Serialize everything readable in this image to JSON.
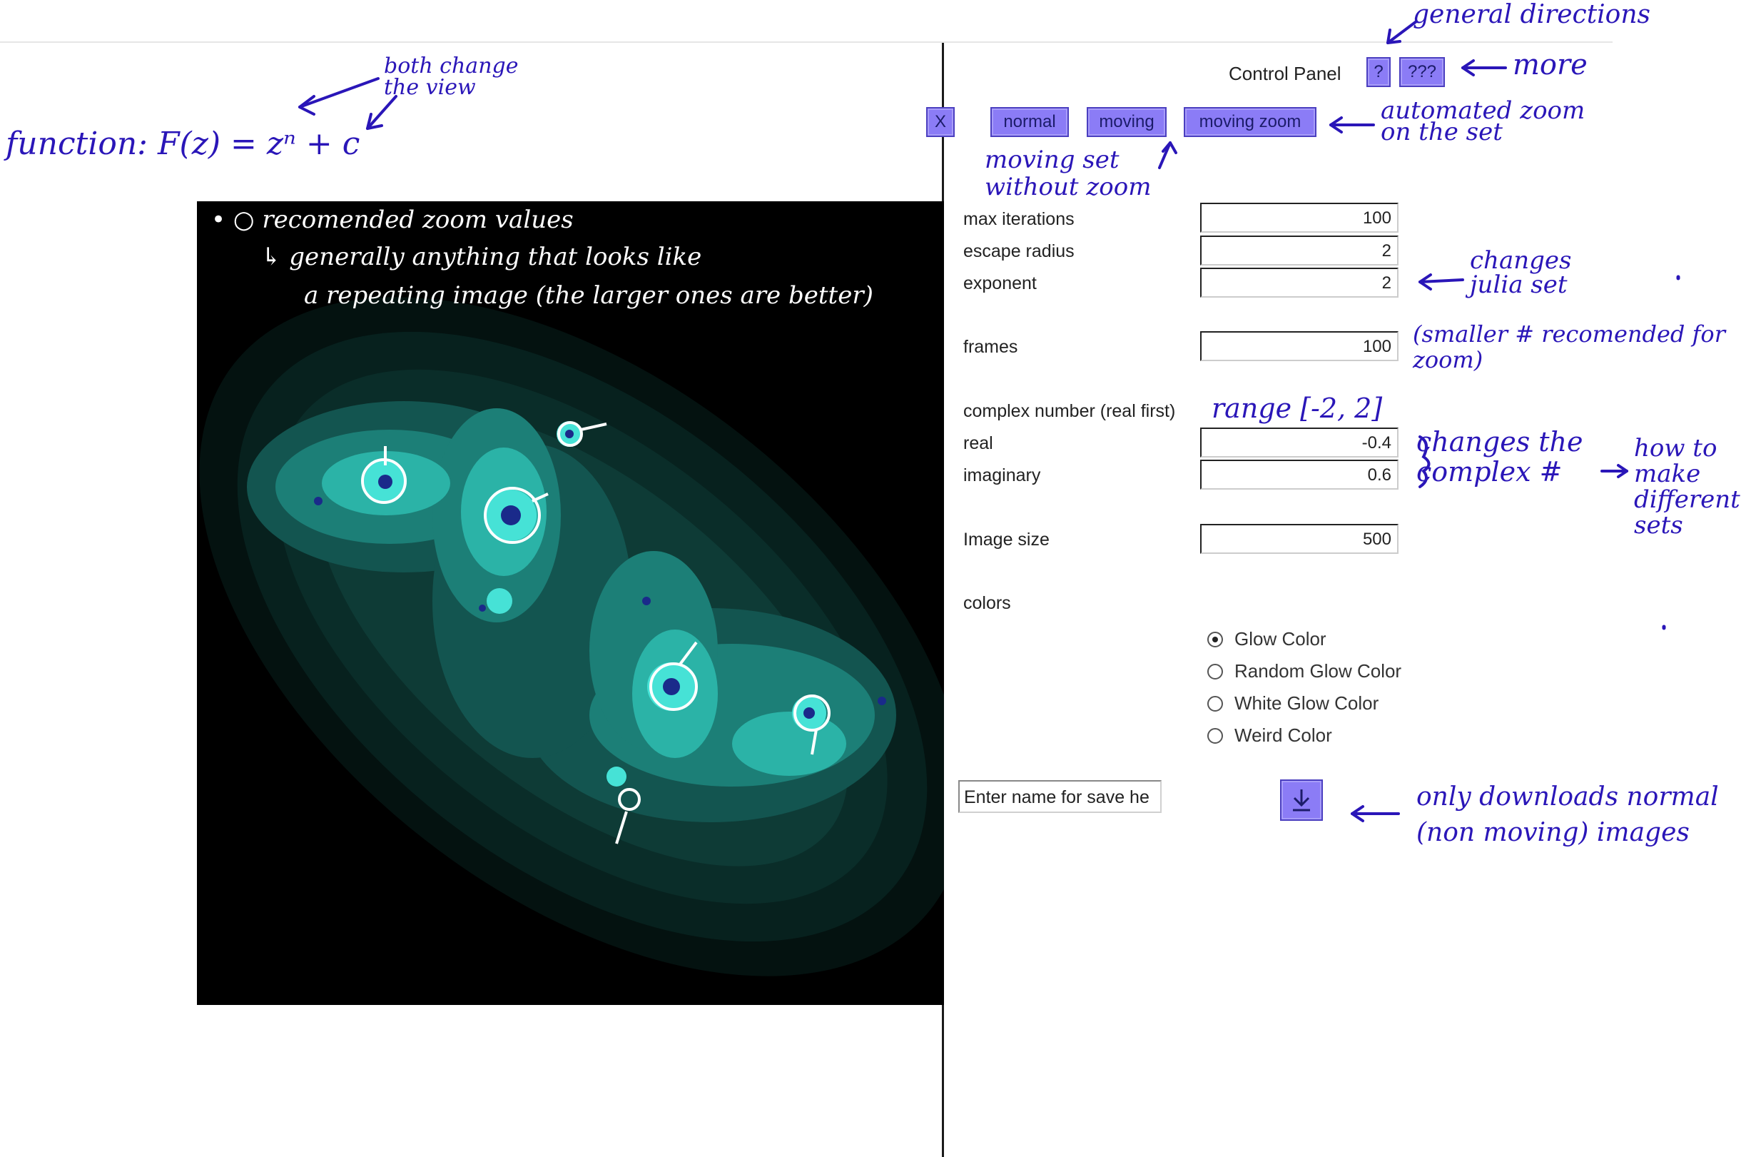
{
  "control_panel": {
    "title": "Control Panel",
    "help_button": "?",
    "more_button": "???",
    "close_button": "X",
    "modes": [
      "normal",
      "moving",
      "moving zoom"
    ]
  },
  "fields": {
    "max_iterations": {
      "label": "max iterations",
      "value": "100"
    },
    "escape_radius": {
      "label": "escape radius",
      "value": "2"
    },
    "exponent": {
      "label": "exponent",
      "value": "2"
    },
    "frames": {
      "label": "frames",
      "value": "100"
    },
    "complex_heading": "complex number (real first)",
    "real": {
      "label": "real",
      "value": "-0.4"
    },
    "imaginary": {
      "label": "imaginary",
      "value": "0.6"
    },
    "image_size": {
      "label": "Image size",
      "value": "500"
    }
  },
  "colors": {
    "heading": "colors",
    "options": [
      "Glow Color",
      "Random Glow Color",
      "White Glow Color",
      "Weird Color"
    ],
    "selected_index": 0
  },
  "save": {
    "placeholder": "Enter name for save he",
    "download_icon": "download-icon"
  },
  "annotations": {
    "function": "function: F(z) = zⁿ + c",
    "both_change": "both change the view",
    "general_directions": "general directions",
    "more": "more",
    "automated_zoom": "automated zoom on the set",
    "moving_set": "moving set without zoom",
    "changes_julia": "changes julia set",
    "smaller_frames": "(smaller # recomended for zoom)",
    "range": "range [-2, 2]",
    "changes_complex": "changes the complex #",
    "how_to": "how to make different sets",
    "only_downloads": "only downloads normal (non moving) images",
    "zoom_note_1": "• ○ recomended zoom values",
    "zoom_note_2": "↳ generally anything that looks like",
    "zoom_note_3": "a repeating image (the larger ones are better)"
  },
  "palette": {
    "accent": "#8b7cf6",
    "ink": "#2a16b8",
    "fractal_bg": "#000000",
    "fractal_glow": "#2fd7c9"
  }
}
